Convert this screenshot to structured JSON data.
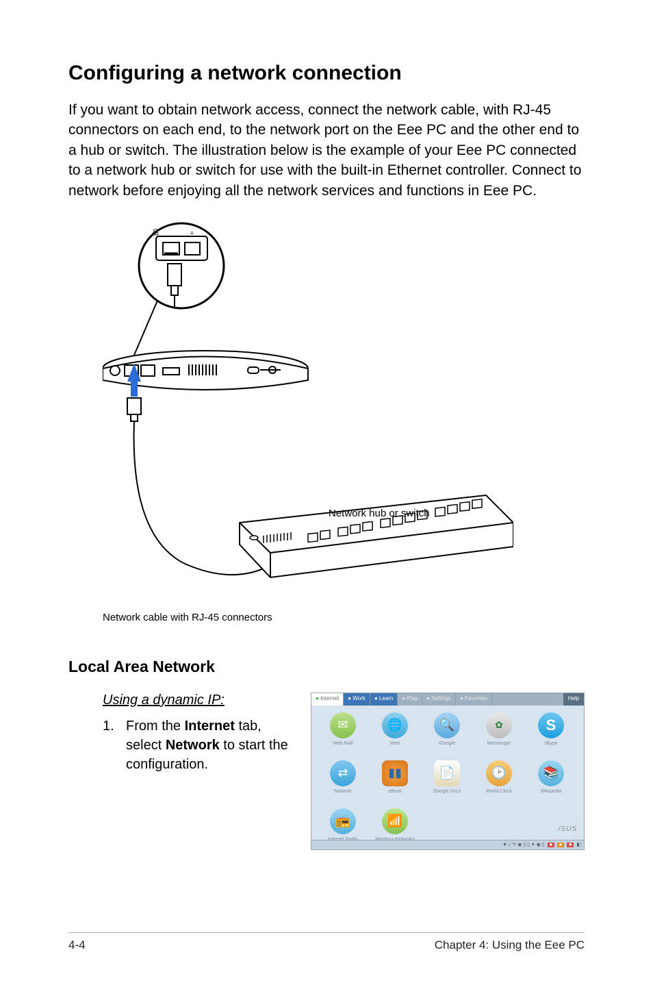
{
  "title": "Configuring a network connection",
  "intro": "If you want to obtain network access, connect the network cable, with RJ-45 connectors on each end, to the network port on the Eee PC and the other end to a hub or switch. The illustration below is the example of your Eee PC connected to a network hub or switch for use with the built-in Ethernet controller. Connect to network before enjoying all the network services and functions in Eee PC.",
  "diagram": {
    "switch_label": "Network hub or switch",
    "rj45_caption": "Network cable with RJ-45 connectors"
  },
  "section_heading": "Local Area Network",
  "sub_heading": "Using a dynamic IP:",
  "step1_num": "1.",
  "step1_a": "From the ",
  "step1_b": "Internet",
  "step1_c": " tab, select ",
  "step1_d": "Network",
  "step1_e": " to start the configuration.",
  "os_tabs": {
    "internet": "Internet",
    "work": "Work",
    "learn": "Learn",
    "play": "Play",
    "settings": "Settings",
    "favorites": "Favorites",
    "help": "Help"
  },
  "apps": {
    "webmail": "Web Mail",
    "web": "Web",
    "google": "iGoogle",
    "messenger": "Messenger",
    "skype": "Skype",
    "network": "Network",
    "ebook": "eBook",
    "googledocs": "Google Docs",
    "worldclock": "World Clock",
    "wikipedia": "Wikipedia",
    "internetradio": "Internet Radio",
    "wireless": "Wireless Networks"
  },
  "brand": "/SUS",
  "footer_left": "4-4",
  "footer_right": "Chapter 4: Using the Eee PC"
}
